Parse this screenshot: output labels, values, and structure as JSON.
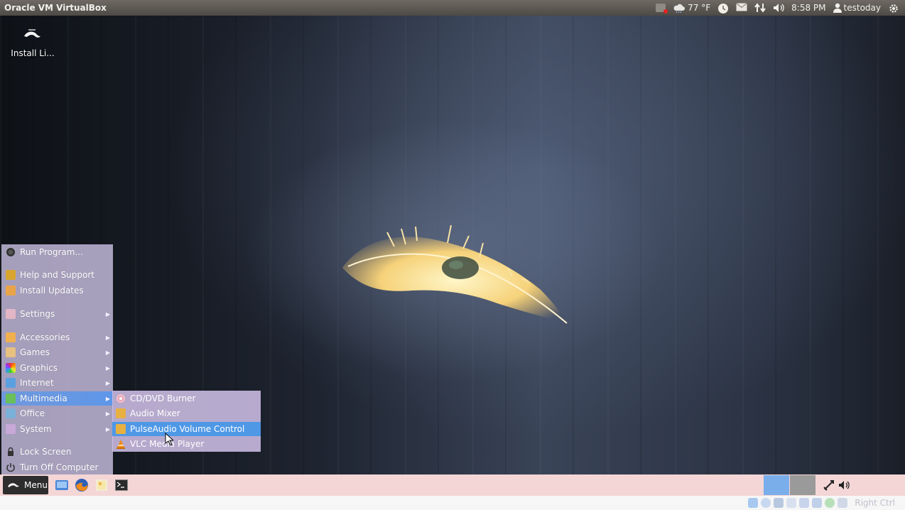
{
  "topbar": {
    "title": "Oracle VM VirtualBox",
    "weather_temp": "77 °F",
    "time": "8:58 PM",
    "user": "testoday",
    "icons": [
      "notification-icon",
      "weather-icon",
      "clock-icon",
      "mail-icon",
      "network-icon",
      "volume-icon",
      "user-icon",
      "settings-gear-icon"
    ]
  },
  "desktop": {
    "install_icon_label": "Install Li..."
  },
  "start_menu": {
    "items": [
      {
        "label": "Run Program...",
        "icon": "gear-icon"
      },
      {
        "label": "Help and Support",
        "icon": "help-icon"
      },
      {
        "label": "Install Updates",
        "icon": "updates-icon"
      },
      {
        "label": "Settings",
        "icon": "settings-icon",
        "has_submenu": true
      },
      {
        "label": "Accessories",
        "icon": "accessories-icon",
        "has_submenu": true
      },
      {
        "label": "Games",
        "icon": "games-icon",
        "has_submenu": true
      },
      {
        "label": "Graphics",
        "icon": "graphics-icon",
        "has_submenu": true
      },
      {
        "label": "Internet",
        "icon": "internet-icon",
        "has_submenu": true
      },
      {
        "label": "Multimedia",
        "icon": "multimedia-icon",
        "has_submenu": true,
        "active": true
      },
      {
        "label": "Office",
        "icon": "office-icon",
        "has_submenu": true
      },
      {
        "label": "System",
        "icon": "system-icon",
        "has_submenu": true
      },
      {
        "label": "Lock Screen",
        "icon": "lock-icon"
      },
      {
        "label": "Turn Off Computer",
        "icon": "power-icon"
      }
    ]
  },
  "multimedia_submenu": {
    "items": [
      {
        "label": "CD/DVD Burner",
        "icon": "disc-burner-icon"
      },
      {
        "label": "Audio Mixer",
        "icon": "audio-mixer-icon"
      },
      {
        "label": "PulseAudio Volume Control",
        "icon": "pulseaudio-icon",
        "active": true
      },
      {
        "label": "VLC Media Player",
        "icon": "vlc-icon"
      }
    ]
  },
  "panel": {
    "menu_label": "Menu",
    "launchers": [
      "file-manager-icon",
      "firefox-icon",
      "image-icon",
      "terminal-icon"
    ],
    "tray": [
      "workspace-switcher",
      "network-tray-icon",
      "volume-tray-icon"
    ]
  },
  "vbox_status": {
    "host_key": "Right Ctrl"
  },
  "colors": {
    "highlight": "#4f98e6",
    "menu_bg": "#c8bee1",
    "panel_bg": "#f4d6d6"
  }
}
